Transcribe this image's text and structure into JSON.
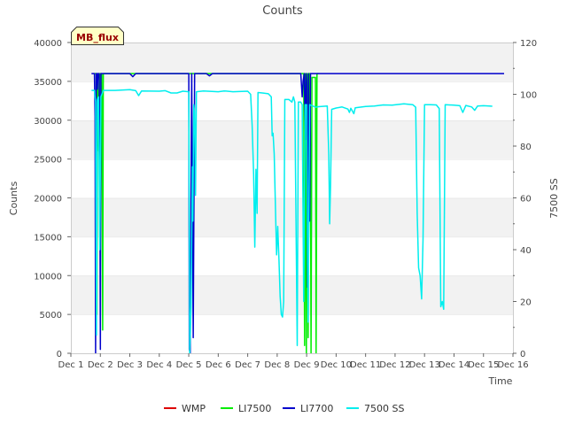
{
  "chart_data": {
    "type": "line",
    "title": "Counts",
    "xlabel": "Time",
    "ylabel": "Counts",
    "y2label": "7500 SS",
    "badge": "MB_flux",
    "grid": true,
    "legend_position": "bottom-center",
    "xlim": [
      0,
      15
    ],
    "ylim": [
      0,
      40000
    ],
    "y2lim": [
      0,
      120
    ],
    "x_ticks": [
      {
        "x": 0,
        "label": "Dec 1"
      },
      {
        "x": 1,
        "label": "Dec 2"
      },
      {
        "x": 2,
        "label": "Dec 3"
      },
      {
        "x": 3,
        "label": "Dec 4"
      },
      {
        "x": 4,
        "label": "Dec 5"
      },
      {
        "x": 5,
        "label": "Dec 6"
      },
      {
        "x": 6,
        "label": "Dec 7"
      },
      {
        "x": 7,
        "label": "Dec 8"
      },
      {
        "x": 8,
        "label": "Dec 9"
      },
      {
        "x": 9,
        "label": "Dec 10"
      },
      {
        "x": 10,
        "label": "Dec 11"
      },
      {
        "x": 11,
        "label": "Dec 12"
      },
      {
        "x": 12,
        "label": "Dec 13"
      },
      {
        "x": 13,
        "label": "Dec 14"
      },
      {
        "x": 14,
        "label": "Dec 15"
      },
      {
        "x": 15,
        "label": "Dec 16"
      }
    ],
    "y_ticks": [
      {
        "v": 0,
        "label": "0"
      },
      {
        "v": 5000,
        "label": "5000"
      },
      {
        "v": 10000,
        "label": "10000"
      },
      {
        "v": 15000,
        "label": "15000"
      },
      {
        "v": 20000,
        "label": "20000"
      },
      {
        "v": 25000,
        "label": "25000"
      },
      {
        "v": 30000,
        "label": "30000"
      },
      {
        "v": 35000,
        "label": "35000"
      },
      {
        "v": 40000,
        "label": "40000"
      }
    ],
    "y2_ticks": [
      {
        "v": 0,
        "label": "0"
      },
      {
        "v": 20,
        "label": "20"
      },
      {
        "v": 40,
        "label": "40"
      },
      {
        "v": 60,
        "label": "60"
      },
      {
        "v": 80,
        "label": "80"
      },
      {
        "v": 100,
        "label": "100"
      },
      {
        "v": 120,
        "label": "120"
      }
    ],
    "series": [
      {
        "name": "WMP",
        "color": "#dd0000",
        "axis": "left",
        "points": []
      },
      {
        "name": "LI7500",
        "color": "#00ee00",
        "axis": "left",
        "points": [
          [
            0.8,
            36000
          ],
          [
            0.86,
            36000
          ],
          [
            0.88,
            5000
          ],
          [
            0.91,
            36000
          ],
          [
            0.95,
            26000
          ],
          [
            0.98,
            36000
          ],
          [
            1.05,
            36000
          ],
          [
            1.08,
            3000
          ],
          [
            1.1,
            36000
          ],
          [
            1.12,
            36000
          ],
          [
            7.8,
            36000
          ],
          [
            7.9,
            36000
          ],
          [
            7.93,
            1000
          ],
          [
            7.96,
            36000
          ],
          [
            7.99,
            0
          ],
          [
            8.02,
            36000
          ],
          [
            8.05,
            2000
          ],
          [
            8.08,
            36000
          ],
          [
            8.12,
            36000
          ],
          [
            8.15,
            0
          ],
          [
            8.18,
            35500
          ],
          [
            8.3,
            35500
          ],
          [
            8.32,
            0
          ],
          [
            8.35,
            36000
          ],
          [
            8.4,
            36000
          ]
        ]
      },
      {
        "name": "LI7700",
        "color": "#0000cc",
        "axis": "left",
        "points": [
          [
            0.7,
            36000
          ],
          [
            0.8,
            36000
          ],
          [
            0.82,
            30500
          ],
          [
            0.84,
            0
          ],
          [
            0.86,
            36000
          ],
          [
            0.88,
            36000
          ],
          [
            0.9,
            34000
          ],
          [
            0.92,
            36000
          ],
          [
            0.96,
            36000
          ],
          [
            0.98,
            26000
          ],
          [
            1.0,
            500
          ],
          [
            1.02,
            36000
          ],
          [
            1.1,
            36000
          ],
          [
            2.0,
            36000
          ],
          [
            2.1,
            35600
          ],
          [
            2.2,
            36000
          ],
          [
            4.0,
            36000
          ],
          [
            4.02,
            500
          ],
          [
            4.05,
            0
          ],
          [
            4.1,
            36000
          ],
          [
            4.15,
            2000
          ],
          [
            4.2,
            36000
          ],
          [
            4.6,
            36000
          ],
          [
            4.7,
            35700
          ],
          [
            4.8,
            36000
          ],
          [
            6.0,
            36000
          ],
          [
            7.0,
            36000
          ],
          [
            7.8,
            36000
          ],
          [
            7.85,
            33000
          ],
          [
            7.88,
            35000
          ],
          [
            7.92,
            36000
          ],
          [
            7.95,
            27500
          ],
          [
            7.98,
            36000
          ],
          [
            8.0,
            35000
          ],
          [
            8.03,
            8500
          ],
          [
            8.06,
            36000
          ],
          [
            8.1,
            17000
          ],
          [
            8.13,
            36000
          ],
          [
            8.4,
            36000
          ],
          [
            9.0,
            36000
          ],
          [
            10.0,
            36000
          ],
          [
            11.0,
            36000
          ],
          [
            12.0,
            36000
          ],
          [
            13.0,
            36000
          ],
          [
            14.0,
            36000
          ],
          [
            14.7,
            36000
          ]
        ]
      },
      {
        "name": "7500 SS",
        "color": "#00eeee",
        "axis": "right",
        "points": [
          [
            0.7,
            101.5
          ],
          [
            0.8,
            101.5
          ],
          [
            0.84,
            97
          ],
          [
            0.87,
            7
          ],
          [
            0.9,
            98
          ],
          [
            0.94,
            99
          ],
          [
            0.98,
            40
          ],
          [
            1.02,
            99
          ],
          [
            1.1,
            101.5
          ],
          [
            1.5,
            101.5
          ],
          [
            2.0,
            101.8
          ],
          [
            2.2,
            101.4
          ],
          [
            2.3,
            99.5
          ],
          [
            2.4,
            101.3
          ],
          [
            3.0,
            101.2
          ],
          [
            3.2,
            101.4
          ],
          [
            3.4,
            100.5
          ],
          [
            3.6,
            100.5
          ],
          [
            3.8,
            101.2
          ],
          [
            4.0,
            101.0
          ],
          [
            4.03,
            0
          ],
          [
            4.08,
            18
          ],
          [
            4.12,
            72
          ],
          [
            4.14,
            51
          ],
          [
            4.17,
            96
          ],
          [
            4.2,
            93
          ],
          [
            4.23,
            61
          ],
          [
            4.26,
            101
          ],
          [
            4.5,
            101.3
          ],
          [
            5.0,
            101.0
          ],
          [
            5.2,
            101.3
          ],
          [
            5.5,
            101.0
          ],
          [
            6.0,
            101.2
          ],
          [
            6.1,
            100.0
          ],
          [
            6.15,
            88
          ],
          [
            6.2,
            69
          ],
          [
            6.24,
            41
          ],
          [
            6.28,
            71
          ],
          [
            6.32,
            54
          ],
          [
            6.35,
            100.7
          ],
          [
            6.5,
            100.5
          ],
          [
            6.7,
            100.2
          ],
          [
            6.8,
            99
          ],
          [
            6.83,
            84
          ],
          [
            6.86,
            85
          ],
          [
            6.9,
            77
          ],
          [
            6.95,
            52
          ],
          [
            6.98,
            38
          ],
          [
            7.02,
            49
          ],
          [
            7.06,
            36
          ],
          [
            7.1,
            22
          ],
          [
            7.14,
            15
          ],
          [
            7.18,
            14
          ],
          [
            7.22,
            20
          ],
          [
            7.26,
            98
          ],
          [
            7.4,
            98
          ],
          [
            7.5,
            97
          ],
          [
            7.55,
            99
          ],
          [
            7.6,
            97
          ],
          [
            7.68,
            3
          ],
          [
            7.72,
            97
          ],
          [
            7.8,
            97
          ],
          [
            7.85,
            96
          ],
          [
            7.9,
            20
          ],
          [
            7.95,
            96
          ],
          [
            8.0,
            96
          ],
          [
            8.05,
            12
          ],
          [
            8.1,
            96
          ],
          [
            8.3,
            95
          ],
          [
            8.4,
            95.2
          ],
          [
            8.6,
            95.4
          ],
          [
            8.7,
            95.5
          ],
          [
            8.75,
            77
          ],
          [
            8.78,
            50
          ],
          [
            8.81,
            65
          ],
          [
            8.85,
            94.2
          ],
          [
            9.0,
            94.7
          ],
          [
            9.2,
            95.1
          ],
          [
            9.4,
            94.3
          ],
          [
            9.45,
            93
          ],
          [
            9.5,
            94.6
          ],
          [
            9.6,
            92.5
          ],
          [
            9.65,
            94.8
          ],
          [
            10.0,
            95.3
          ],
          [
            10.3,
            95.5
          ],
          [
            10.6,
            95.9
          ],
          [
            10.9,
            95.8
          ],
          [
            11.3,
            96.3
          ],
          [
            11.6,
            96.0
          ],
          [
            11.7,
            95
          ],
          [
            11.75,
            54
          ],
          [
            11.8,
            33
          ],
          [
            11.85,
            30
          ],
          [
            11.9,
            21
          ],
          [
            11.95,
            44
          ],
          [
            12.0,
            96.0
          ],
          [
            12.2,
            96.0
          ],
          [
            12.4,
            95.9
          ],
          [
            12.5,
            94.5
          ],
          [
            12.55,
            18
          ],
          [
            12.6,
            20
          ],
          [
            12.65,
            17
          ],
          [
            12.7,
            96.0
          ],
          [
            13.0,
            95.8
          ],
          [
            13.2,
            95.6
          ],
          [
            13.3,
            93
          ],
          [
            13.4,
            95.7
          ],
          [
            13.6,
            95.1
          ],
          [
            13.7,
            93.8
          ],
          [
            13.8,
            95.5
          ],
          [
            14.0,
            95.6
          ],
          [
            14.2,
            95.5
          ],
          [
            14.3,
            95.4
          ]
        ]
      }
    ]
  }
}
